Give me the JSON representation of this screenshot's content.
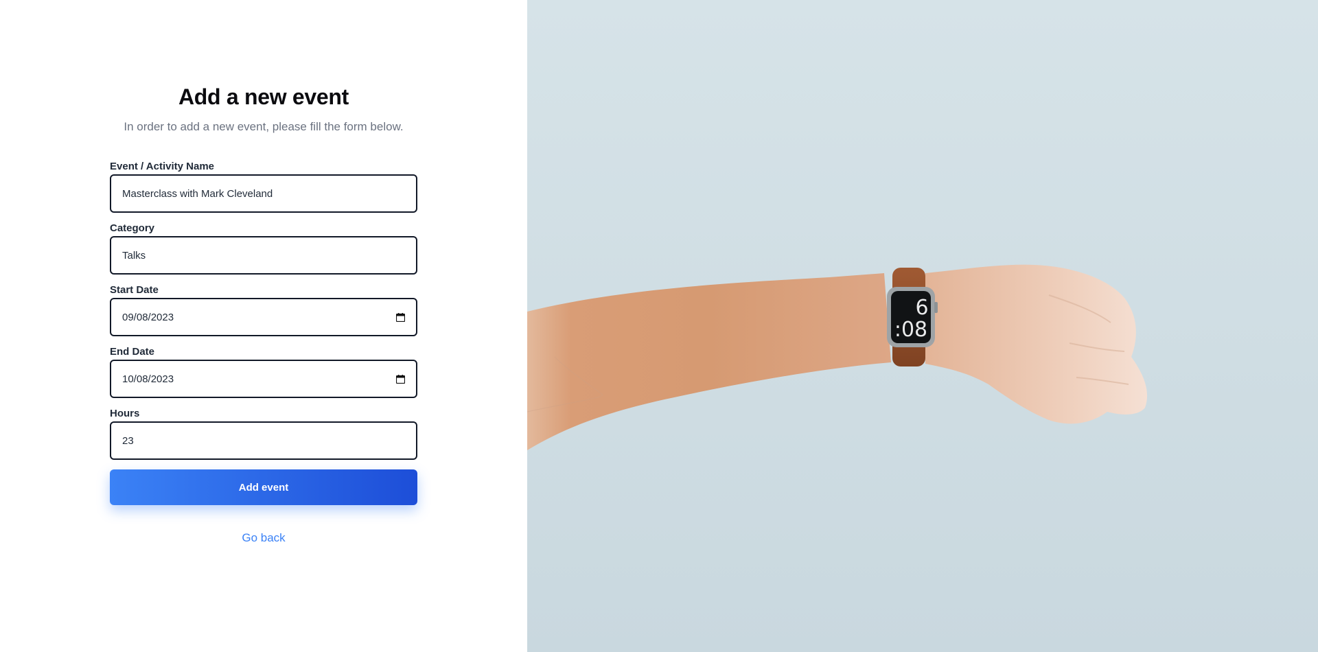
{
  "header": {
    "title": "Add a new event",
    "subtitle": "In order to add a new event, please fill the form below."
  },
  "form": {
    "event_name": {
      "label": "Event / Activity Name",
      "value": "Masterclass with Mark Cleveland"
    },
    "category": {
      "label": "Category",
      "value": "Talks"
    },
    "start_date": {
      "label": "Start Date",
      "value": "09/08/2023",
      "icon": "calendar-icon"
    },
    "end_date": {
      "label": "End Date",
      "value": "10/08/2023",
      "icon": "calendar-icon"
    },
    "hours": {
      "label": "Hours",
      "value": "23"
    },
    "submit_label": "Add event",
    "back_label": "Go back"
  },
  "photo": {
    "watch_hour": "6",
    "watch_minutes": ":08"
  },
  "colors": {
    "accent": "#3b82f6",
    "accent_dark": "#1d4ed8",
    "photo_background": "#d3e1e7"
  }
}
